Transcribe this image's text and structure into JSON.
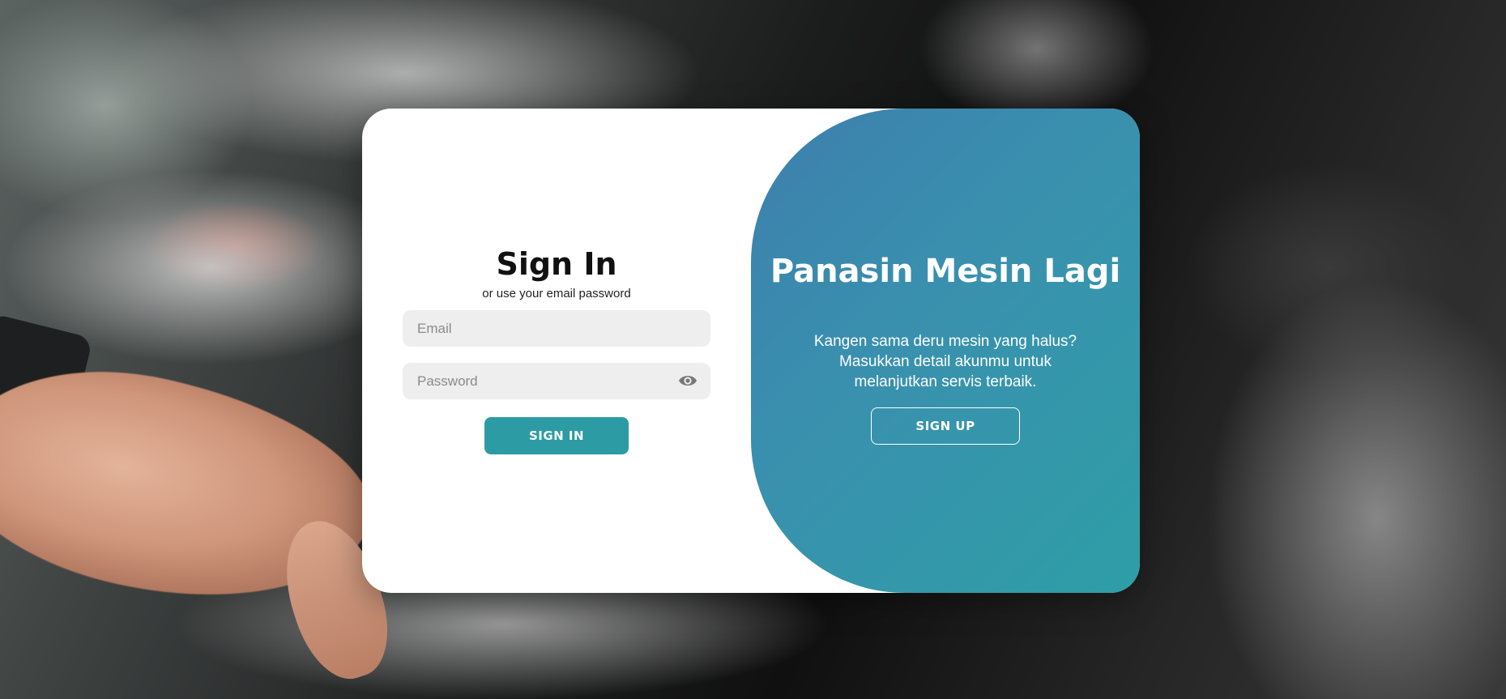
{
  "signin": {
    "title": "Sign In",
    "subtitle": "or use your email password",
    "email_placeholder": "Email",
    "email_value": "",
    "password_placeholder": "Password",
    "password_value": "",
    "submit_label": "SIGN IN"
  },
  "promo": {
    "title": "Panasin Mesin Lagi",
    "text": "Kangen sama deru mesin yang halus? Masukkan detail akunmu untuk melanjutkan servis terbaik.",
    "signup_label": "SIGN UP"
  },
  "colors": {
    "accent": "#2d9ba4",
    "promo_gradient_start": "#3d7fad",
    "promo_gradient_end": "#2e9ea6",
    "input_bg": "#eeeeee"
  },
  "icons": {
    "password_toggle": "eye-icon"
  }
}
